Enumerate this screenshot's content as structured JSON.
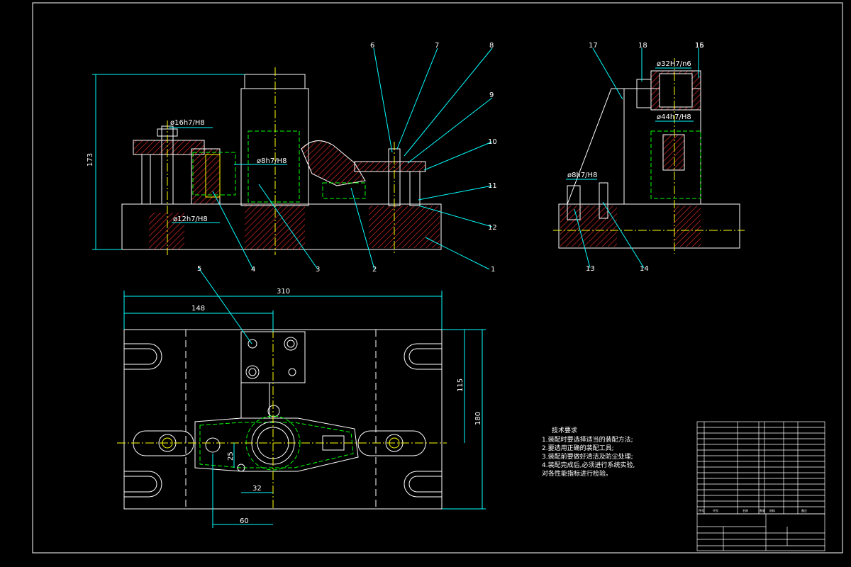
{
  "colors": {
    "background": "#000000",
    "outline": "#ffffff",
    "leader": "#00ffff",
    "hatch": "#ff3030",
    "green": "#00ff00",
    "yellow": "#ffff00",
    "centerline": "#ffff00"
  },
  "front_view": {
    "overall_height": "173",
    "fit_bore": "ø16h7/H8",
    "fit_pin": "ø8h7/H8",
    "fit_bush": "ø12h7/H8"
  },
  "side_view": {
    "fit_top": "ø32H7/n6",
    "fit_mid": "ø44h7/H8",
    "fit_pin": "ø8h7/H8"
  },
  "plan_view": {
    "width": "310",
    "offset": "148",
    "height_outer": "180",
    "height_inner": "115",
    "dim_32": "32",
    "dim_60": "60",
    "dim_25": "25"
  },
  "balloons": [
    "1",
    "2",
    "3",
    "4",
    "5",
    "6",
    "7",
    "8",
    "9",
    "10",
    "11",
    "12",
    "13",
    "14",
    "15",
    "16",
    "17",
    "18"
  ],
  "notes": {
    "title": "技术要求",
    "lines": [
      "1.装配时要选择适当的装配方法;",
      "2.要选用正确的装配工具;",
      "3.装配前要做好清洁及防尘处理;",
      "4.装配完成后,必须进行系统实验,",
      "对各性能指标进行检验。"
    ]
  },
  "title_block": {
    "header_cells": [
      "序号",
      "代号",
      "名称",
      "数量",
      "材料",
      "备注"
    ]
  }
}
